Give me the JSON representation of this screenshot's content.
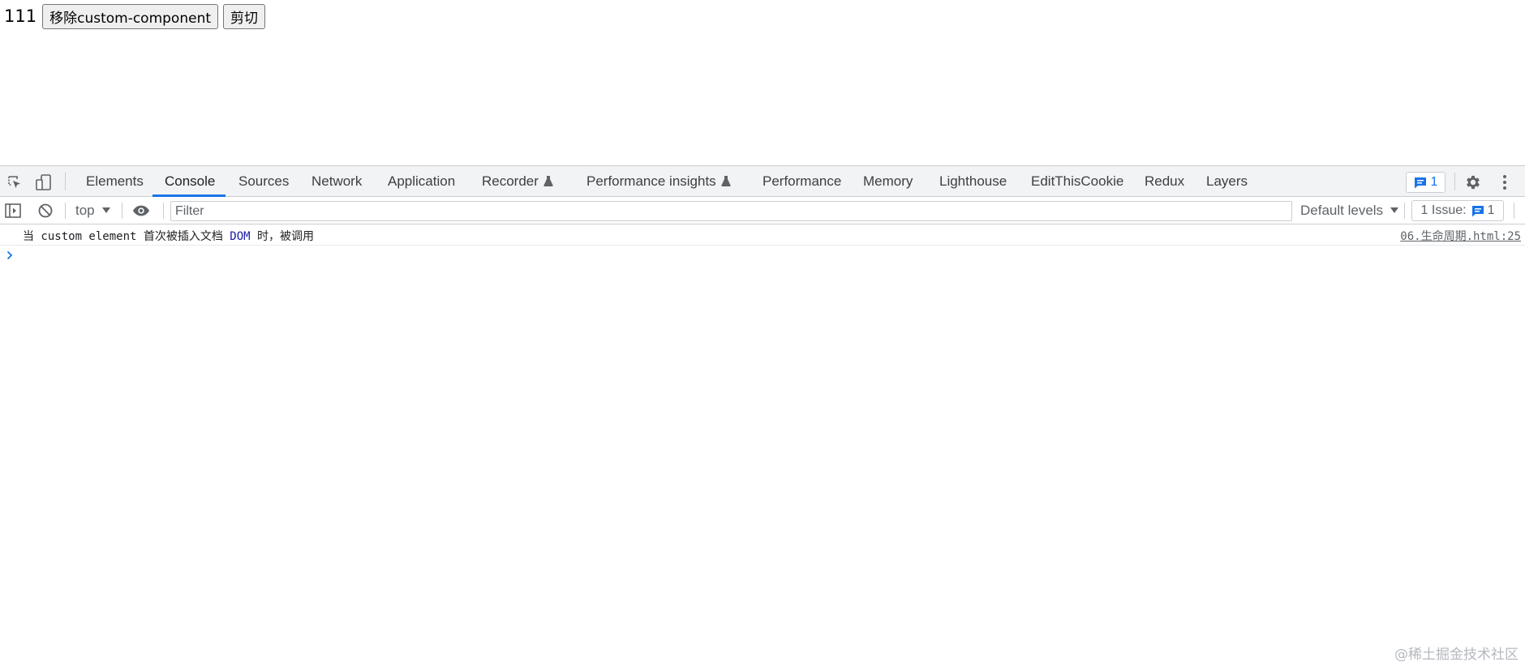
{
  "page": {
    "counter": "111",
    "remove_button_label": "移除custom-component",
    "cut_button_label": "剪切"
  },
  "devtools": {
    "tabs": [
      {
        "label": "Elements"
      },
      {
        "label": "Console",
        "active": true
      },
      {
        "label": "Sources"
      },
      {
        "label": "Network"
      },
      {
        "label": "Application"
      },
      {
        "label": "Recorder",
        "experimental": true
      },
      {
        "label": "Performance insights",
        "experimental": true
      },
      {
        "label": "Performance"
      },
      {
        "label": "Memory"
      },
      {
        "label": "Lighthouse"
      },
      {
        "label": "EditThisCookie"
      },
      {
        "label": "Redux"
      },
      {
        "label": "Layers"
      }
    ],
    "messages_badge_count": "1",
    "console_toolbar": {
      "context": "top",
      "filter_placeholder": "Filter",
      "filter_value": "",
      "levels_label": "Default levels",
      "issues_label": "1 Issue:",
      "issues_count": "1"
    },
    "console_messages": [
      {
        "text_before": "当 custom element 首次被插入文档 ",
        "text_dom": "DOM",
        "text_after": " 时，被调用",
        "source": "06.生命周期.html:25"
      }
    ],
    "icons": {
      "inspect": "inspect-element-icon",
      "device": "device-toolbar-icon",
      "sidebar": "sidebar-toggle-icon",
      "clear": "clear-console-icon",
      "eye": "live-expression-eye-icon",
      "settings": "gear-icon",
      "more": "kebab-menu-icon",
      "flask": "experimental-flask-icon",
      "message": "message-bubble-icon",
      "prompt": "chevron-right-icon"
    },
    "colors": {
      "accent": "#1a73e8",
      "tabbar_bg": "#f1f3f4",
      "border": "#cbcdd1"
    }
  },
  "watermark": "@稀土掘金技术社区"
}
